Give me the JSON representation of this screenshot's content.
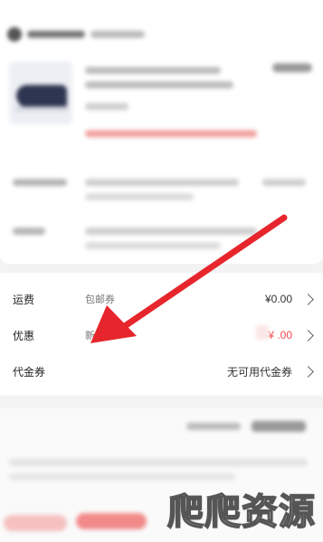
{
  "fees": [
    {
      "label": "运费",
      "sub": "包邮券",
      "value": "¥0.00"
    },
    {
      "label": "优惠",
      "sub": "新",
      "value": "-¥  .00"
    },
    {
      "label": "代金券",
      "sub": "",
      "value": "无可用代金券"
    }
  ],
  "watermark": "爬爬资源",
  "colors": {
    "discount_red": "#f0484e",
    "arrow_red": "#e6262c"
  },
  "icons": [
    "shoe-product-thumbnail",
    "chevron-right-icon",
    "arrow-annotation"
  ]
}
